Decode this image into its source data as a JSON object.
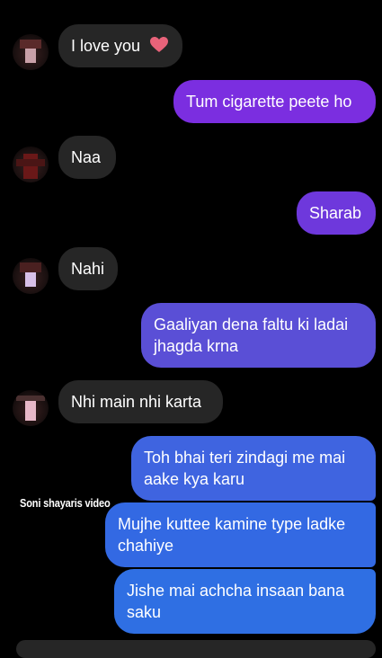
{
  "messages": [
    {
      "side": "in",
      "text": "I love you",
      "emoji": "heart-icon"
    },
    {
      "side": "out",
      "text": "Tum cigarette peete ho"
    },
    {
      "side": "in",
      "text": "Naa"
    },
    {
      "side": "out",
      "text": "Sharab"
    },
    {
      "side": "in",
      "text": "Nahi"
    },
    {
      "side": "out",
      "text": "Gaaliyan dena faltu ki ladai jhagda krna"
    },
    {
      "side": "in",
      "text": "Nhi main nhi karta"
    },
    {
      "side": "out",
      "text": "Toh bhai teri zindagi me mai aake kya karu"
    },
    {
      "side": "out",
      "text": "Mujhe kuttee kamine type ladke chahiye"
    },
    {
      "side": "out",
      "text": "Jishe mai achcha insaan bana saku"
    }
  ],
  "watermark": "Soni shayaris video",
  "colors": {
    "incoming": "#262626",
    "outgoing_top": "#7b2ee0",
    "outgoing_mid": "#5a4fd6",
    "outgoing_bottom": "#2f6fe3",
    "heart": "#e8637a"
  }
}
